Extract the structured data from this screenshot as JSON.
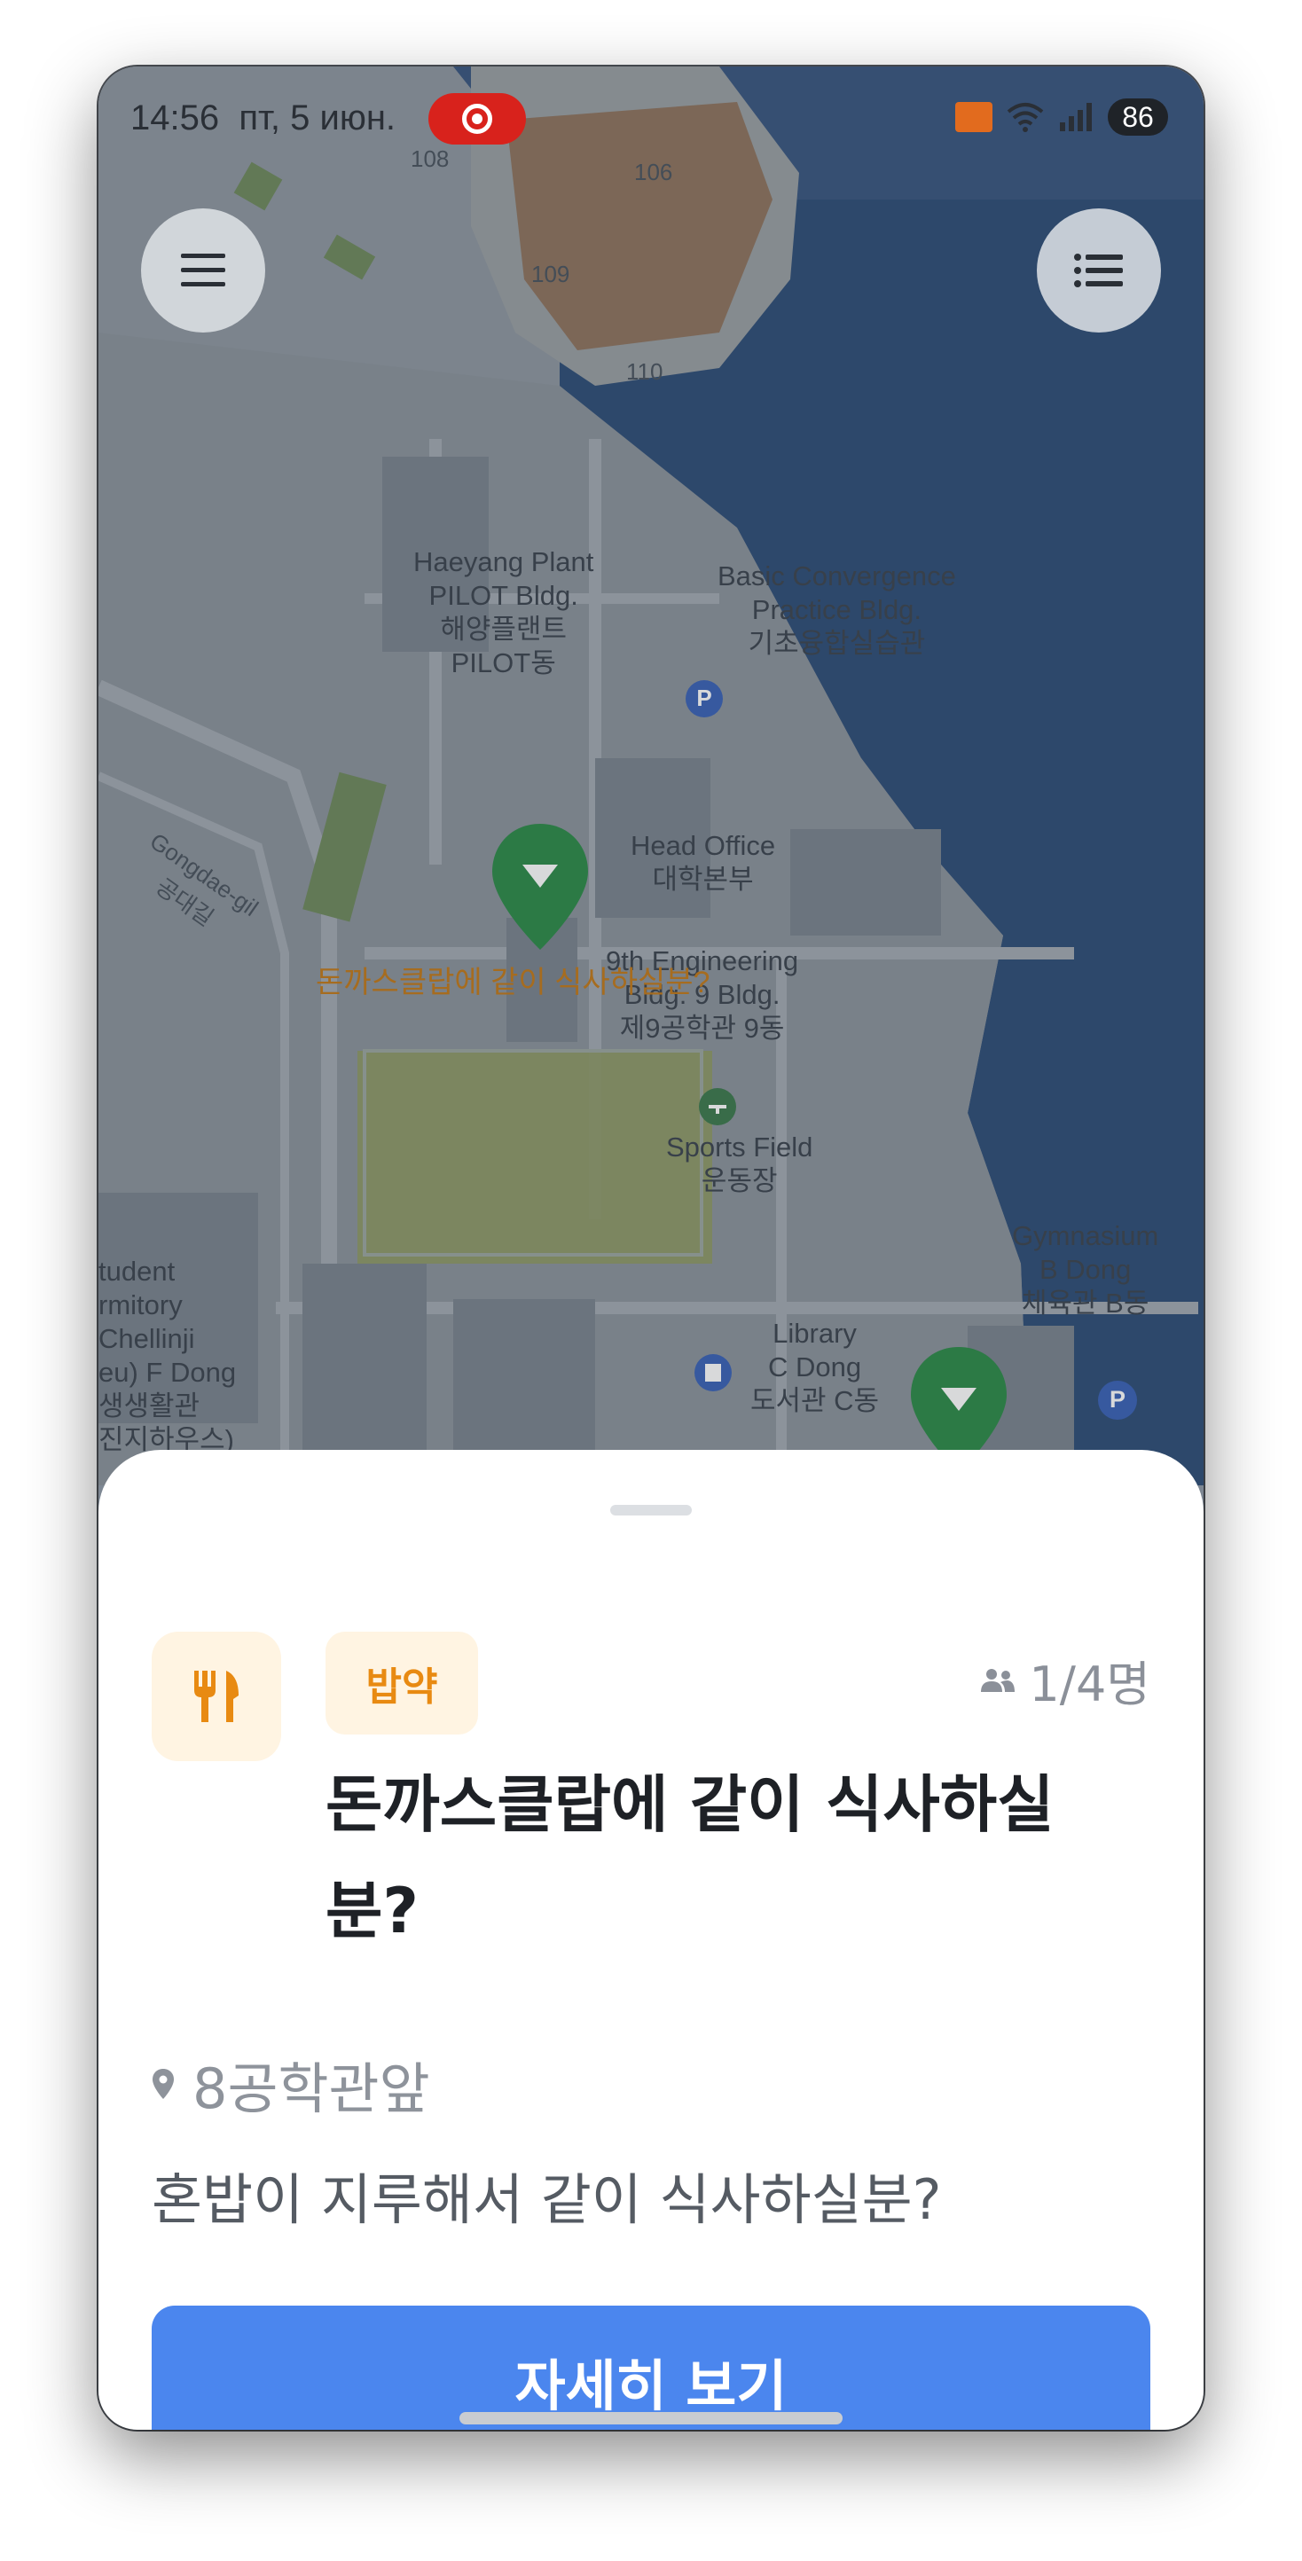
{
  "status_bar": {
    "time": "14:56",
    "date": "пт, 5 июн.",
    "battery": "86"
  },
  "map": {
    "labels": {
      "b108": "108",
      "b106": "106",
      "b109": "109",
      "b110": "110",
      "haeyang_en1": "Haeyang Plant",
      "haeyang_en2": "PILOT Bldg.",
      "haeyang_ko1": "해양플랜트",
      "haeyang_ko2": "PILOT동",
      "basic_en1": "Basic Convergence",
      "basic_en2": "Practice Bldg.",
      "basic_ko": "기초융합실습관",
      "road_en": "Gongdae-gil",
      "road_ko": "공대길",
      "head_en": "Head Office",
      "head_ko": "대학본부",
      "eng_en1": "9th Engineering",
      "eng_en2": "Bldg. 9 Bldg.",
      "eng_ko": "제9공학관 9동",
      "sports_en": "Sports Field",
      "sports_ko": "운동장",
      "gym_en1": "Gymnasium",
      "gym_en2": "B Dong",
      "gym_ko": "체육관 B동",
      "student_1": "tudent",
      "student_2": "rmitory",
      "student_3": "Chellinji",
      "student_4": "eu) F Dong",
      "student_5": "생생활관",
      "student_6": "진지하우스)",
      "library_en1": "Library",
      "library_en2": "C Dong",
      "library_ko": "도서관 C동",
      "parking": "P"
    },
    "marker_title": "돈까스클랍에 같이 식사하실분?"
  },
  "sheet": {
    "category": "밥약",
    "participants": "1/4명",
    "title_line1": "돈까스클랍에 같이 식사하실",
    "title_line2": "분?",
    "location": "8공학관앞",
    "description": "혼밥이 지루해서 같이 식사하실분?",
    "cta_label": "자세히 보기"
  },
  "colors": {
    "accent_blue": "#4b86ee",
    "category_orange": "#e88a12",
    "marker_green": "#2e8b4a"
  }
}
